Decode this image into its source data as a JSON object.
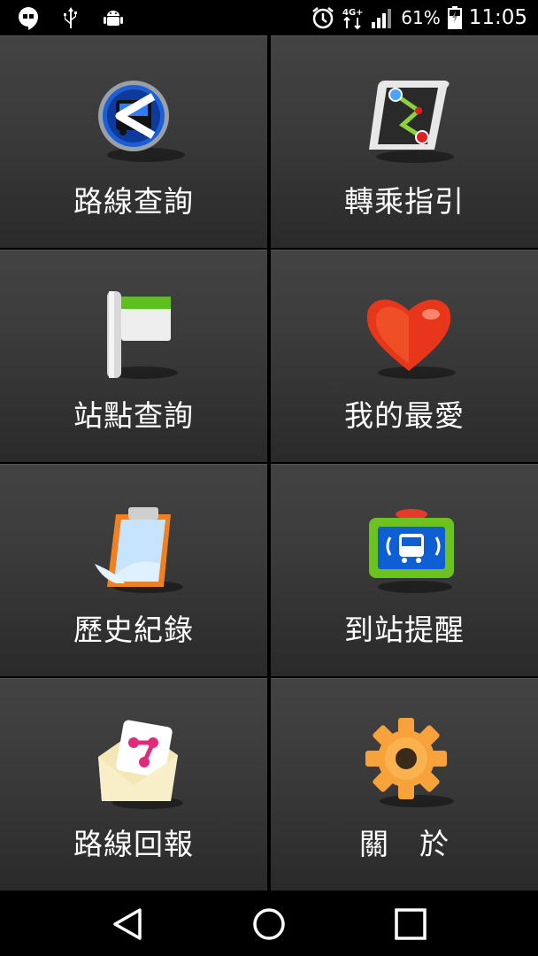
{
  "status_bar": {
    "battery_percent": "61%",
    "time": "11:05",
    "network": "4G+",
    "icons": [
      "hangouts-icon",
      "usb-icon",
      "android-debug-icon",
      "alarm-icon",
      "network-icon",
      "signal-icon",
      "battery-icon"
    ]
  },
  "menu": {
    "items": [
      {
        "label": "路線查詢",
        "icon": "bus-route-icon"
      },
      {
        "label": "轉乘指引",
        "icon": "transfer-map-icon"
      },
      {
        "label": "站點查詢",
        "icon": "flag-icon"
      },
      {
        "label": "我的最愛",
        "icon": "heart-icon"
      },
      {
        "label": "歷史紀錄",
        "icon": "clipboard-icon"
      },
      {
        "label": "到站提醒",
        "icon": "bus-alert-icon"
      },
      {
        "label": "路線回報",
        "icon": "envelope-share-icon"
      },
      {
        "label": "關　於",
        "icon": "gear-icon"
      }
    ]
  },
  "nav_bar": {
    "icons": [
      "back-icon",
      "home-icon",
      "recents-icon"
    ]
  },
  "colors": {
    "tile_top": "#434343",
    "tile_bottom": "#2a2a2a",
    "background": "#000000",
    "text": "#ffffff"
  }
}
